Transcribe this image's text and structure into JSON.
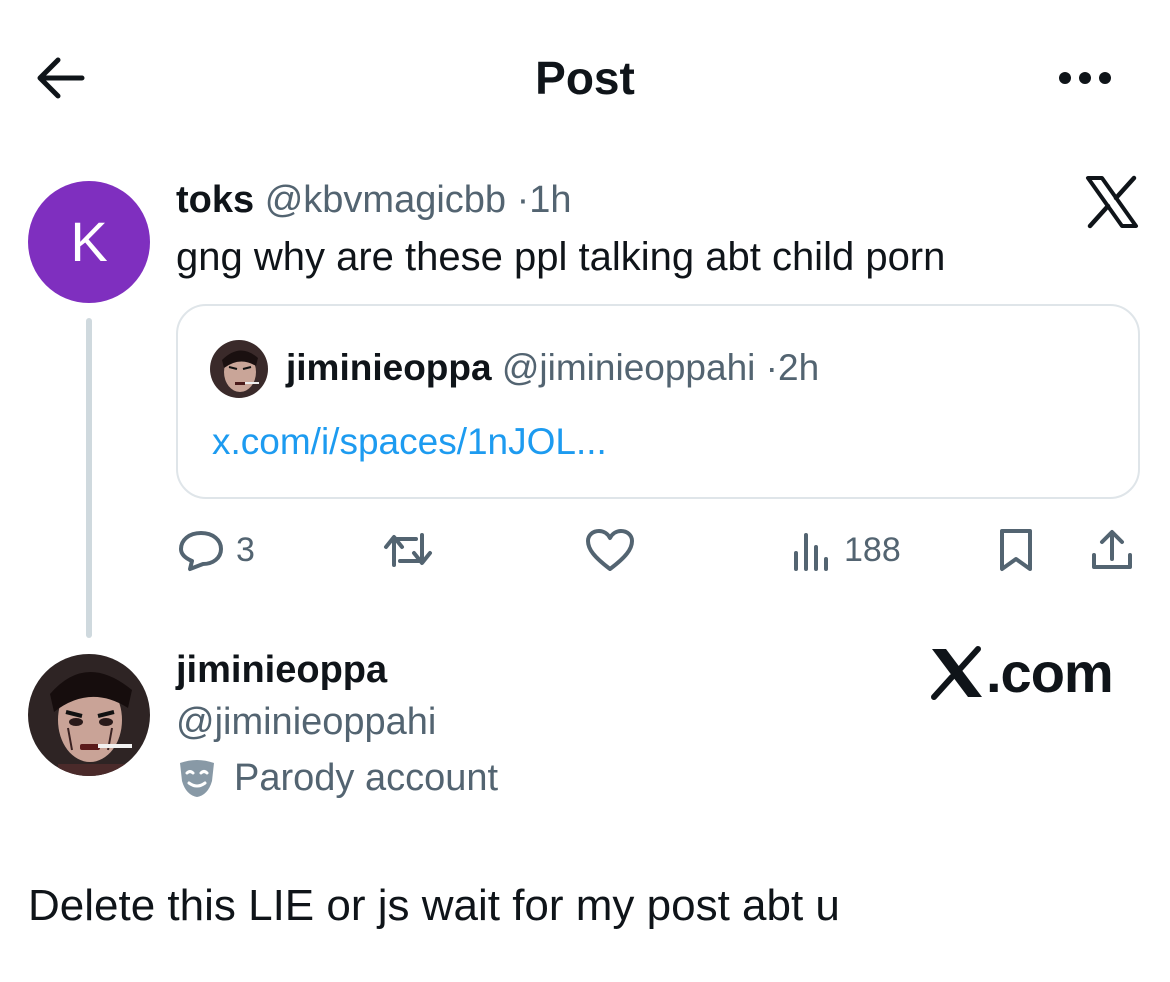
{
  "header": {
    "title": "Post"
  },
  "post": {
    "author_name": "toks",
    "author_handle": "@kbvmagicbb",
    "separator": "·",
    "time": "1h",
    "avatar_letter": "K",
    "text": "gng why are these ppl talking abt child porn",
    "quote": {
      "author_name": "jiminieoppa",
      "author_handle": "@jiminieoppahi",
      "time": "2h",
      "link": "x.com/i/spaces/1nJOL..."
    },
    "actions": {
      "replies": "3",
      "views": "188"
    }
  },
  "profile": {
    "name": "jiminieoppa",
    "handle": "@jiminieoppahi",
    "label": "Parody account",
    "brand": ".com"
  },
  "reply": {
    "text": "Delete this LIE or js wait for my post abt u"
  },
  "colors": {
    "accent": "#1d9bf0",
    "avatar_purple": "#7f2fbf",
    "muted": "#536471"
  },
  "icons": [
    "back-arrow-icon",
    "more-icon",
    "x-logo-icon",
    "reply-icon",
    "repost-icon",
    "like-icon",
    "views-icon",
    "bookmark-icon",
    "share-icon",
    "parody-mask-icon"
  ]
}
